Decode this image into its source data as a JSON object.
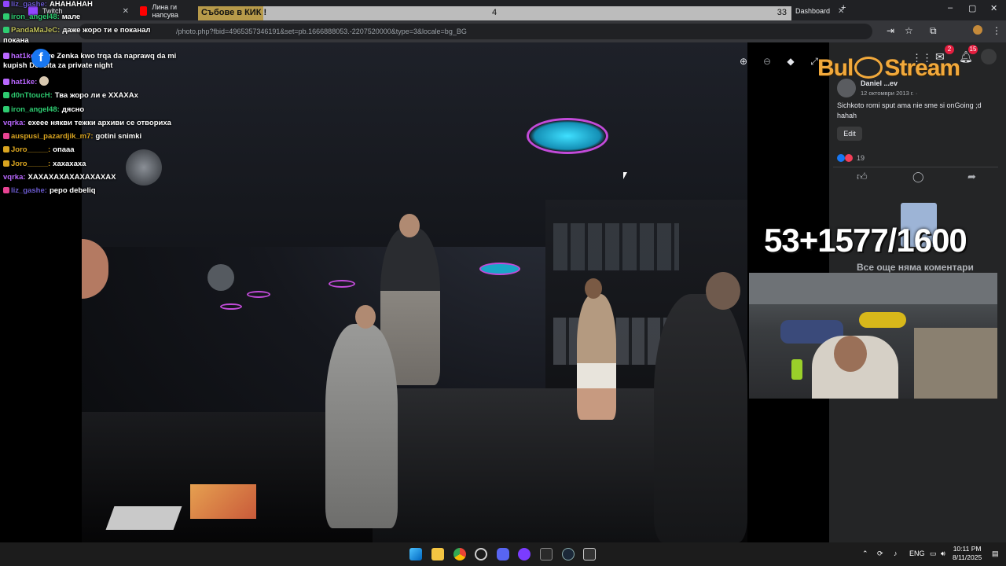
{
  "browser": {
    "tabs": [
      {
        "label": "Twitch"
      },
      {
        "label": "Лина ги напсува"
      },
      {
        "label": "Dashboard"
      }
    ],
    "address": "/photo.php?fbid=4965357346191&set=pb.1666888053.-2207520000&type=3&locale=bg_BG"
  },
  "chat": {
    "messages": [
      {
        "user": "liz_gashe:",
        "text": "АНАНАНАН",
        "color": "#6a5acd"
      },
      {
        "user": "iron_angel48:",
        "text": "мале",
        "color": "#2ecc71"
      },
      {
        "user": "PandaMaJeC:",
        "text": "даже жоро ти е поканал",
        "color": "#c0c05a"
      },
      {
        "user": "",
        "text": "покана",
        "color": "#ffffff"
      },
      {
        "user": "hat1ke:",
        "text": "Awe Zenka kwo trqa da naprawq da mi",
        "color": "#b967ff"
      },
      {
        "user": "",
        "text": "kupish Dessita za private night",
        "color": "#ffffff"
      },
      {
        "user": "hat1ke:",
        "text": "",
        "color": "#b967ff"
      },
      {
        "user": "d0nTtoucH:",
        "text": "Тва жоро ли е ХХАХАх",
        "color": "#2ecc71"
      },
      {
        "user": "iron_angel48:",
        "text": "дясно",
        "color": "#2ecc71"
      },
      {
        "user": "vqrka:",
        "text": "ехеее някви тежки архиви се отвориха",
        "color": "#b967ff"
      },
      {
        "user": "auspusi_pazardjik_m7:",
        "text": "gotini snimki",
        "color": "#daa520"
      },
      {
        "user": "Joro_____:",
        "text": "опааа",
        "color": "#daa520"
      },
      {
        "user": "Joro_____:",
        "text": "хахахаха",
        "color": "#daa520"
      },
      {
        "user": "vqrka:",
        "text": "ХАХАХАХАХАХАХАХАХ",
        "color": "#b967ff"
      },
      {
        "user": "liz_gashe:",
        "text": "pepo debeliq",
        "color": "#6a5acd"
      }
    ]
  },
  "poll": {
    "title": "Събове в КИК !",
    "left_count": "4",
    "right_count": "33",
    "fraction": 0.11
  },
  "post": {
    "author": "Daniel ...ev",
    "date": "12 октомври 2013 г. ·",
    "caption": "Sichkoto romi sput ama nie sme si onGoing ;d",
    "caption2": "hahah",
    "edit_label": "Edit",
    "reactions": "19",
    "no_comments": "Все още няма коментари"
  },
  "overlay": {
    "logo_a": "Bul",
    "logo_b": "Stream",
    "counter": "53+1577/1600"
  },
  "notifications": {
    "messenger": "2",
    "bell": "15"
  },
  "taskbar": {
    "lang": "ENG",
    "time": "10:11 PM",
    "date": "8/11/2025"
  }
}
